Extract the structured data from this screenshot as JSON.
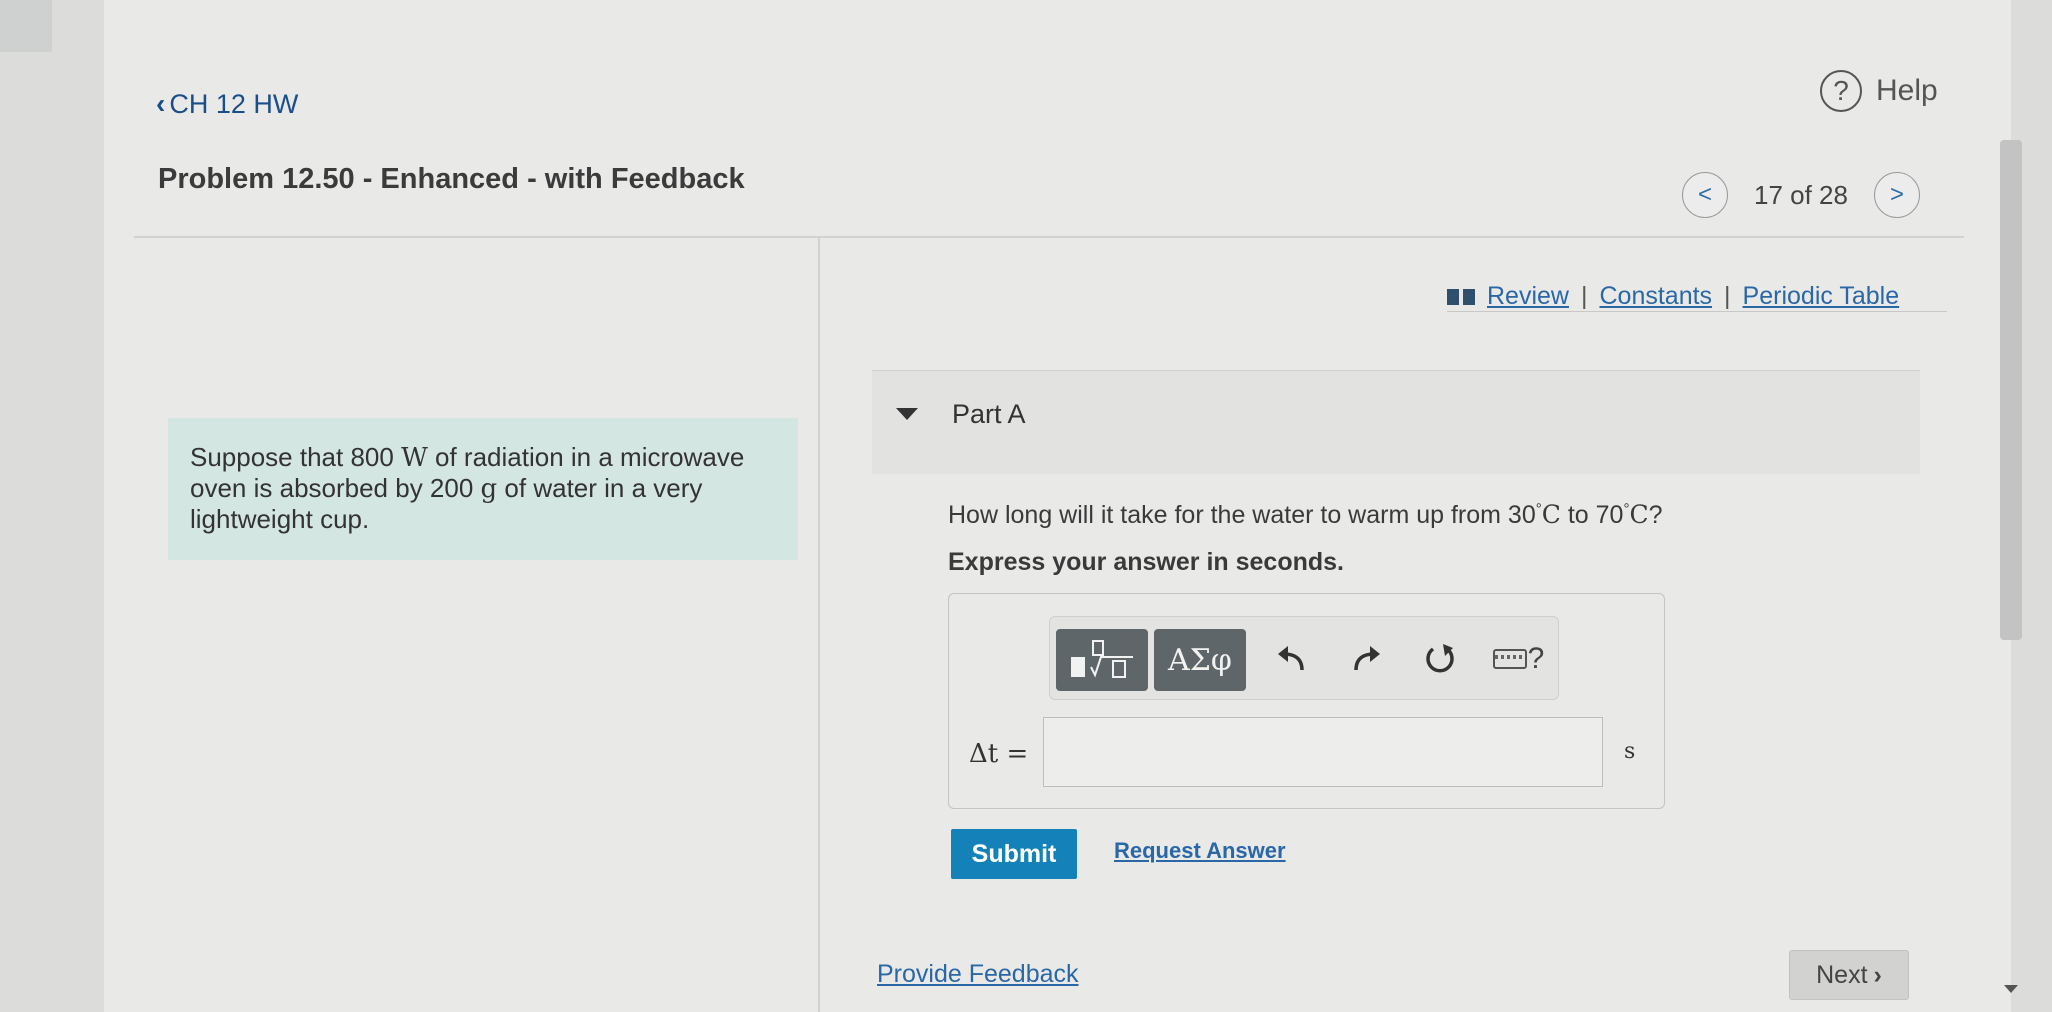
{
  "nav": {
    "back_label": "CH 12 HW",
    "help_label": "Help",
    "problem_title": "Problem 12.50 - Enhanced - with Feedback",
    "pager_text": "17 of 28"
  },
  "resources": {
    "review": "Review",
    "separator": "|",
    "constants": "Constants",
    "periodic_table": "Periodic Table"
  },
  "intro": {
    "text_1": "Suppose that 800 ",
    "unit_w": "W",
    "text_2": " of radiation in a microwave oven is absorbed by 200 ",
    "unit_g": "g",
    "text_3": " of water in a very lightweight cup."
  },
  "part": {
    "label": "Part A",
    "question_1": "How long will it take for the water to warm up from 30",
    "deg_1": "°",
    "unit_c_1": "C",
    "question_2": " to 70",
    "deg_2": "°",
    "unit_c_2": "C",
    "question_3": "?",
    "instruction": "Express your answer in seconds."
  },
  "answer": {
    "greek_button": "ΑΣφ",
    "help_symbol": "?",
    "variable_label": "Δt =",
    "value": "",
    "unit": "s"
  },
  "actions": {
    "submit": "Submit",
    "request_answer": "Request Answer",
    "provide_feedback": "Provide Feedback",
    "next": "Next"
  }
}
